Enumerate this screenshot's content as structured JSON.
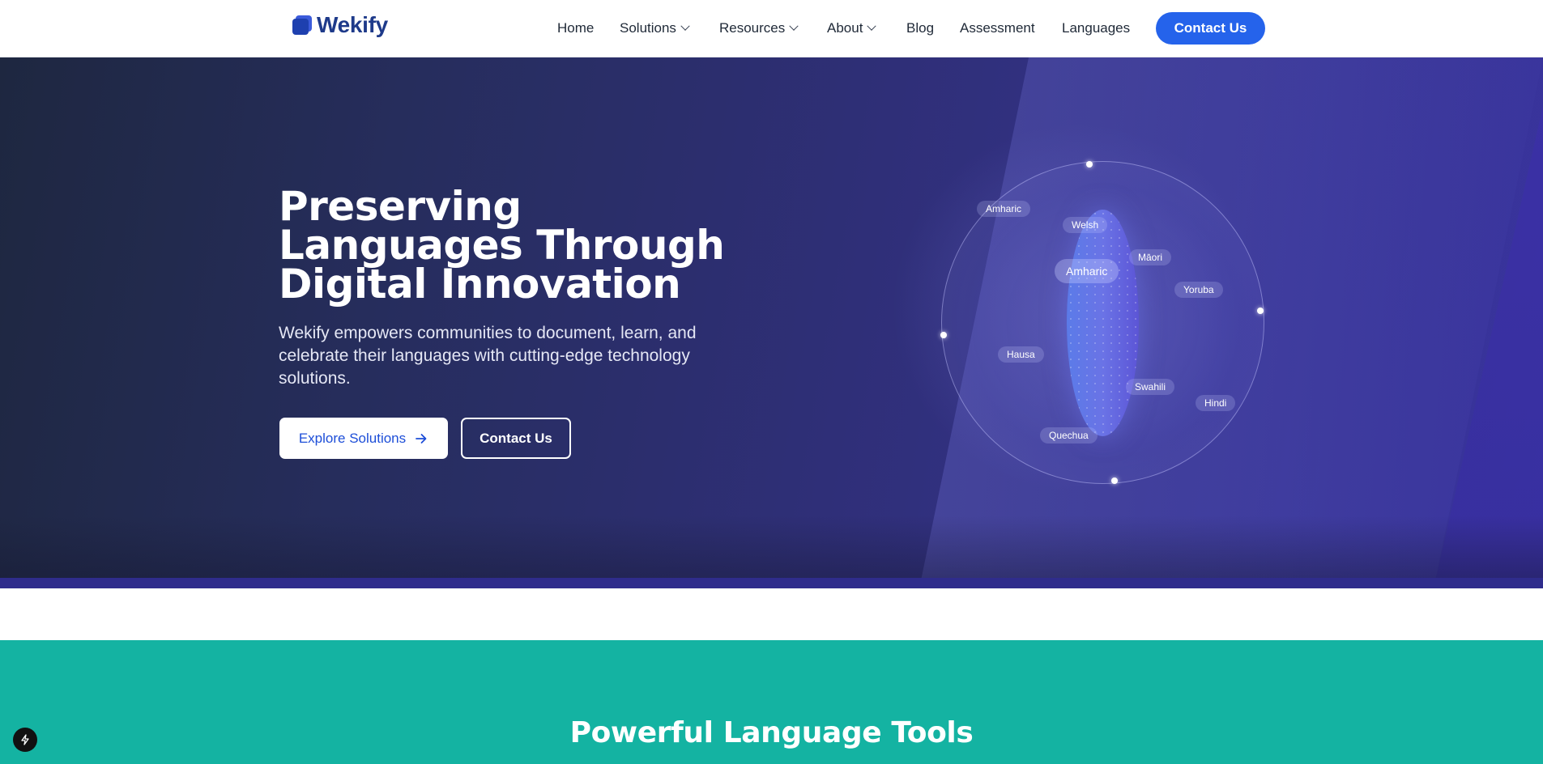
{
  "brand": {
    "name": "Wekify"
  },
  "nav": {
    "items": [
      {
        "label": "Home",
        "has_dropdown": false
      },
      {
        "label": "Solutions",
        "has_dropdown": true
      },
      {
        "label": "Resources",
        "has_dropdown": true
      },
      {
        "label": "About",
        "has_dropdown": true
      },
      {
        "label": "Blog",
        "has_dropdown": false
      },
      {
        "label": "Assessment",
        "has_dropdown": false
      },
      {
        "label": "Languages",
        "has_dropdown": false
      }
    ],
    "cta_label": "Contact Us"
  },
  "hero": {
    "title": "Preserving Languages Through Digital Innovation",
    "subtitle": "Wekify empowers communities to document, learn, and celebrate their languages with cutting-edge technology solutions.",
    "primary_button": "Explore Solutions",
    "secondary_button": "Contact Us",
    "globe": {
      "center_label": "Amharic",
      "languages": [
        "Amharic",
        "Welsh",
        "Māori",
        "Yoruba",
        "Hausa",
        "Swahili",
        "Hindi",
        "Quechua"
      ]
    }
  },
  "tools_section": {
    "title": "Powerful Language Tools"
  },
  "icons": {
    "logo": "stacked-squares-icon",
    "dropdown": "chevron-down-icon",
    "arrow": "arrow-right-icon",
    "badge": "lightning-bolt-icon"
  },
  "colors": {
    "primary": "#2563eb",
    "brand_text": "#1e3a8a",
    "hero_dark": "#1e2740",
    "hero_purple": "#3a34a0",
    "teal": "#14b3a2"
  }
}
